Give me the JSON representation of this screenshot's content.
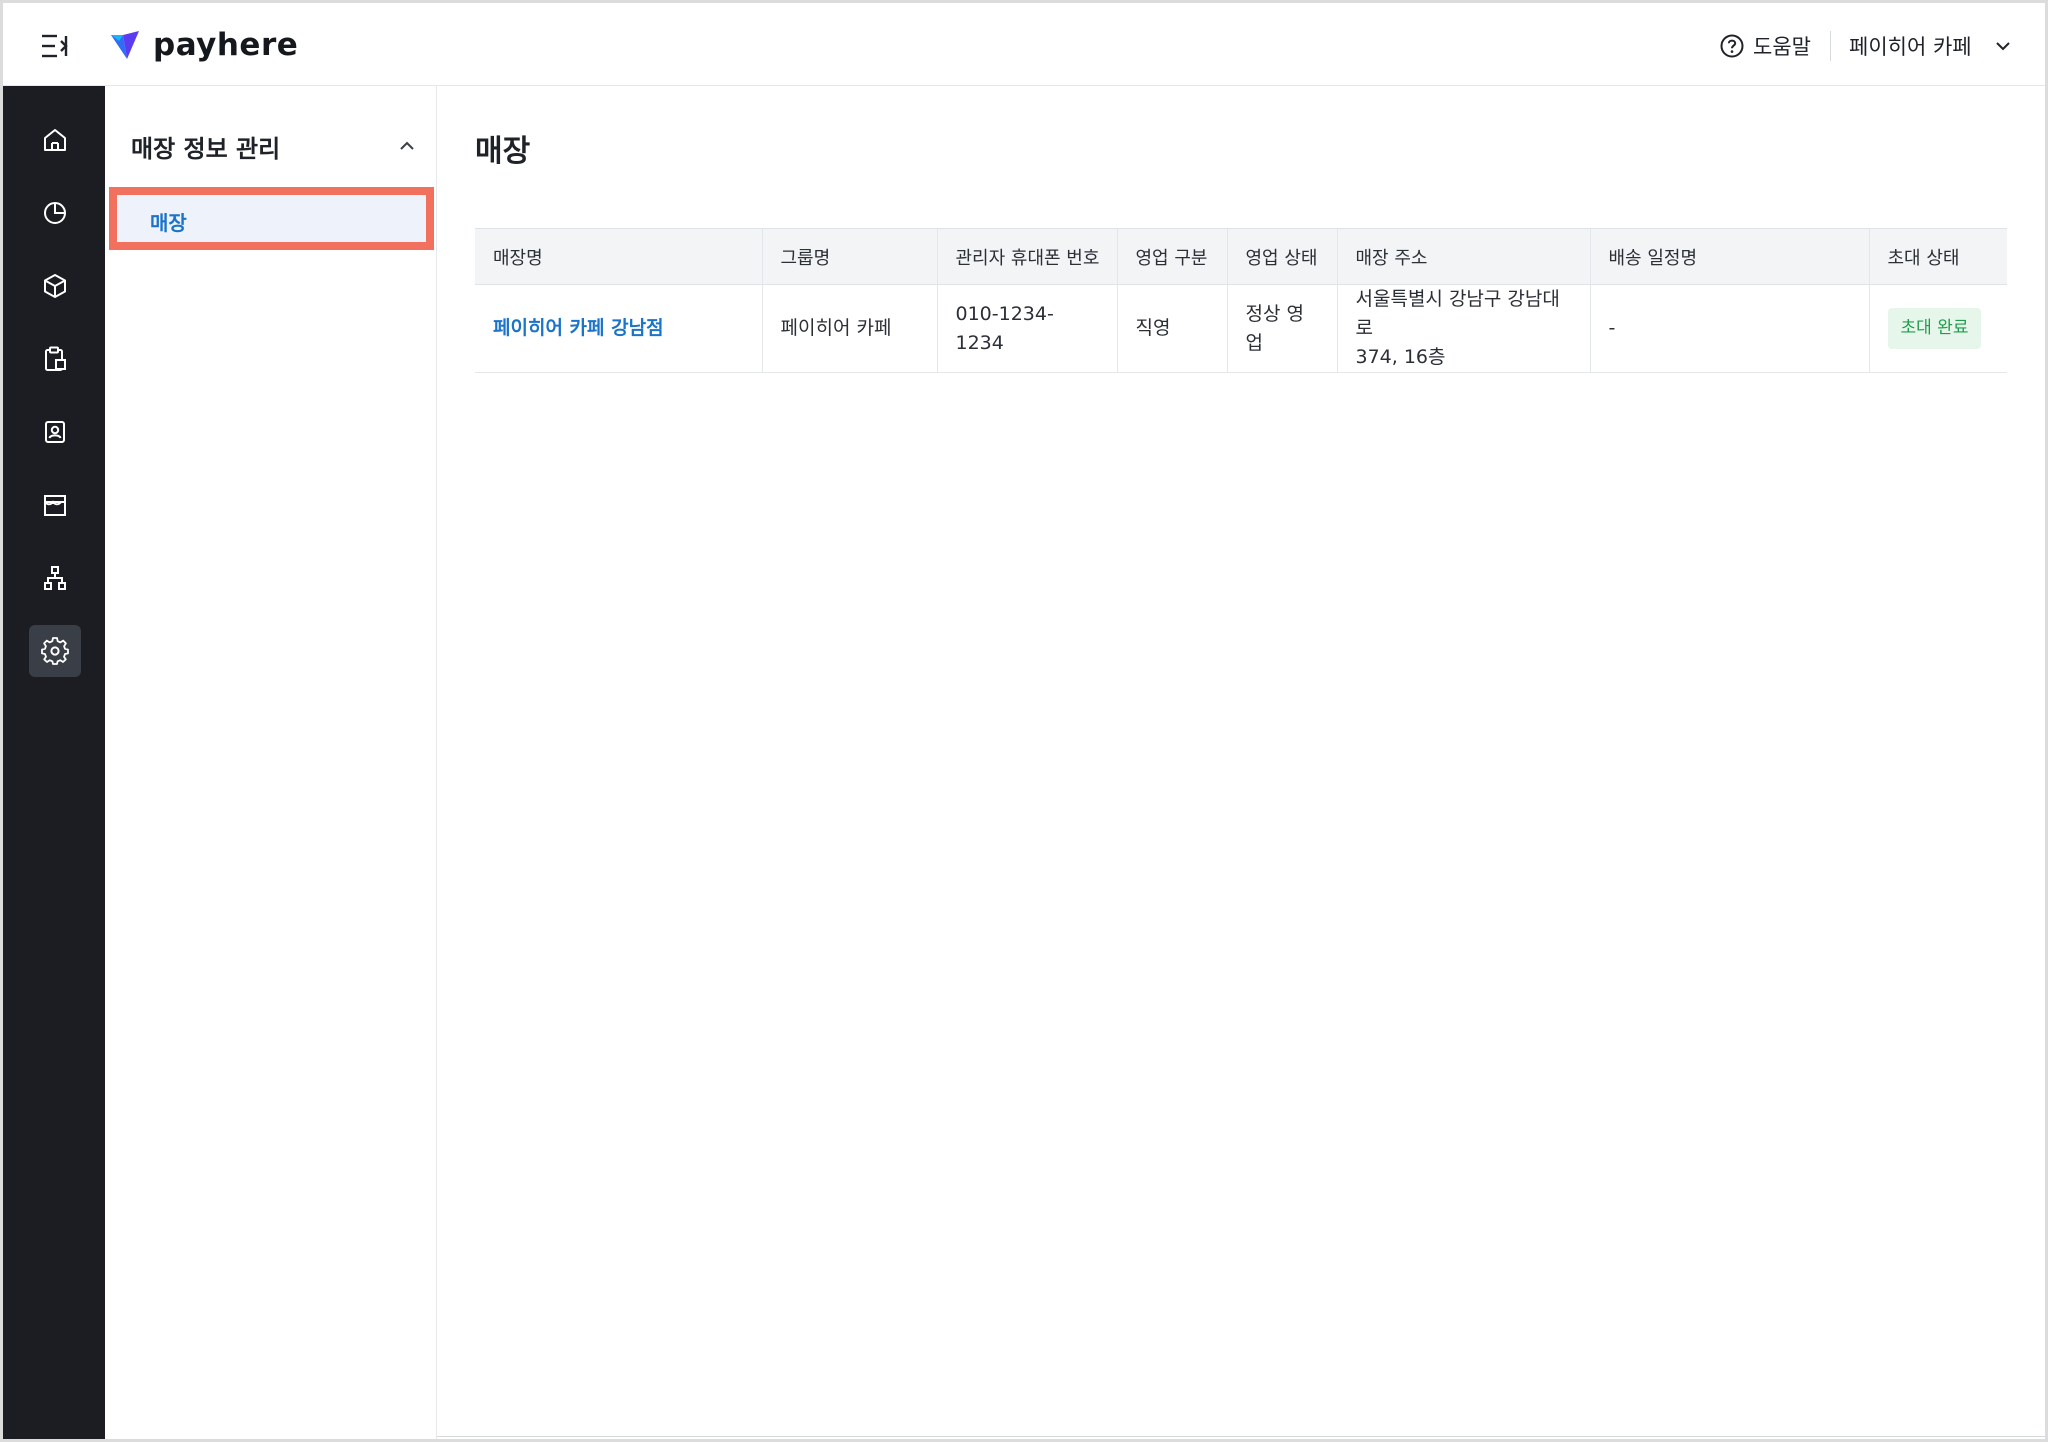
{
  "header": {
    "logo_text": "payhere",
    "help_label": "도움말",
    "store_name": "페이히어 카페"
  },
  "rail": {
    "items": [
      {
        "icon": "home-icon"
      },
      {
        "icon": "pie-chart-icon"
      },
      {
        "icon": "box-icon"
      },
      {
        "icon": "clipboard-icon"
      },
      {
        "icon": "contact-card-icon"
      },
      {
        "icon": "store-icon"
      },
      {
        "icon": "org-chart-icon"
      },
      {
        "icon": "gear-icon",
        "active": true
      }
    ]
  },
  "subnav": {
    "section_title": "매장 정보 관리",
    "items": [
      {
        "label": "매장",
        "selected": true
      }
    ]
  },
  "main": {
    "title": "매장",
    "table": {
      "columns": [
        "매장명",
        "그룹명",
        "관리자 휴대폰 번호",
        "영업 구분",
        "영업 상태",
        "매장 주소",
        "배송 일정명",
        "초대 상태"
      ],
      "rows": [
        {
          "store_name": "페이히어 카페 강남점",
          "group_name": "페이히어 카페",
          "phone": "010-1234-1234",
          "business_type": "직영",
          "business_status": "정상 영업",
          "address_line1": "서울특별시 강남구 강남대로",
          "address_line2": "374, 16층",
          "delivery_schedule": "-",
          "invite_status": "초대 완료"
        }
      ]
    }
  },
  "colors": {
    "rail_bg": "#1b1d22",
    "accent_blue": "#1c74c8",
    "highlight_border": "#f1705e",
    "badge_green": "#1f9d4c"
  }
}
